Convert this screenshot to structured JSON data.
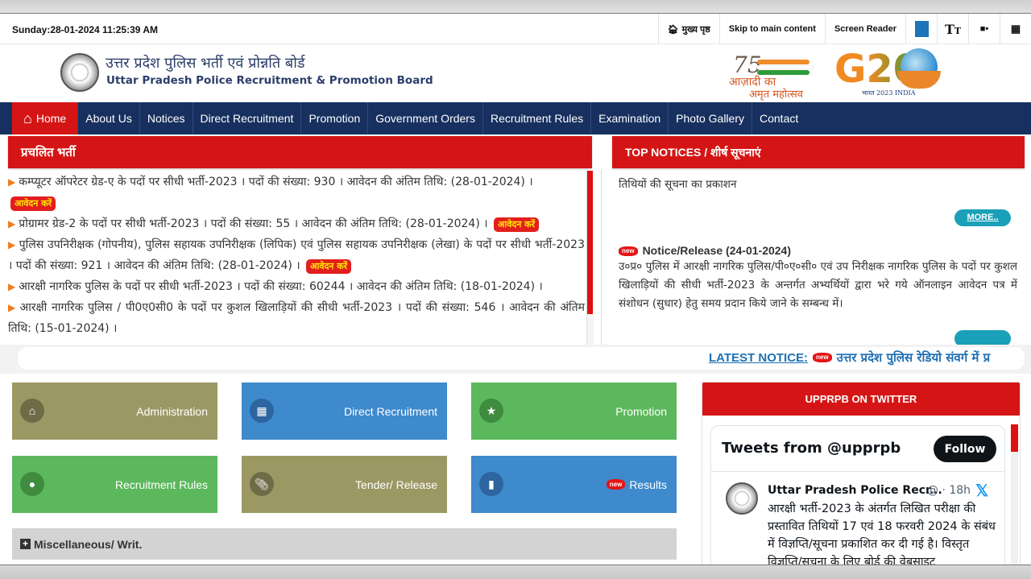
{
  "topbar": {
    "datetime": "Sunday:28-01-2024 11:25:39 AM",
    "links": [
      {
        "icon": "home-icon",
        "label": "मुख्य पृष्ठ"
      },
      {
        "label": "Skip to main content"
      },
      {
        "label": "Screen Reader"
      }
    ],
    "icons": [
      "color-theme-icon",
      "text-size-icon",
      "social-media-icon",
      "sitemap-icon"
    ],
    "theme_color": "#1e74b8"
  },
  "header": {
    "title_hindi": "उत्तर प्रदेश पुलिस भर्ती एवं प्रोन्नति बोर्ड",
    "title_english": "Uttar Pradesh Police Recruitment & Promotion Board",
    "azadi_line1": "आज़ादी का",
    "azadi_line2": "अमृत महोत्सव",
    "azadi_number": "75",
    "g20_text": "G20",
    "g20_sub": "भारत 2023 INDIA"
  },
  "nav": {
    "items": [
      "Home",
      "About Us",
      "Notices",
      "Direct Recruitment",
      "Promotion",
      "Government Orders",
      "Recruitment Rules",
      "Examination",
      "Photo Gallery",
      "Contact"
    ],
    "active": "Home"
  },
  "current_recruitment": {
    "title": "प्रचलित भर्ती",
    "apply_label": "आवेदन करें",
    "items": [
      {
        "text": "कम्प्यूटर ऑपरेटर ग्रेड-ए के पदों पर सीधी भर्ती-2023 । पदों की संख्या: 930 । आवेदन की अंतिम तिथि: (28-01-2024) ।",
        "apply": true
      },
      {
        "text": "प्रोग्रामर ग्रेड-2 के पदों पर सीधी भर्ती-2023 । पदों की संख्या: 55 । आवेदन की अंतिम तिथि: (28-01-2024) ।",
        "apply": true
      },
      {
        "text": "पुलिस उपनिरीक्षक (गोपनीय), पुलिस सहायक उपनिरीक्षक (लिपिक) एवं पुलिस सहायक उपनिरीक्षक (लेखा) के पदों पर सीधी भर्ती-2023 । पदों की संख्या: 921 । आवेदन की अंतिम तिथि: (28-01-2024) ।",
        "apply": true
      },
      {
        "text": "आरक्षी नागरिक पुलिस के पदों पर सीधी भर्ती-2023 । पदों की संख्या: 60244 । आवेदन की अंतिम तिथि: (18-01-2024) ।",
        "apply": false
      },
      {
        "text": "आरक्षी नागरिक पुलिस / पी0ए0सी0 के पदों पर कुशल खिलाड़ियों की सीधी भर्ती-2023 । पदों की संख्या: 546 । आवेदन की अंतिम तिथि: (15-01-2024) ।",
        "apply": false
      }
    ]
  },
  "top_notices": {
    "title": "TOP NOTICES / शीर्ष सूचनाएं",
    "partial_text": "तिथियों की सूचना का प्रकाशन",
    "more_label": "MORE..",
    "new_label": "new",
    "notice_title": "Notice/Release (24-01-2024)",
    "notice_text": "उ०प्र० पुलिस में आरक्षी नागरिक पुलिस/पी०ए०सी० एवं उप निरीक्षक नागरिक पुलिस के पदों पर कुशल खिलाड़ियों की सीधी भर्ती-2023 के अन्तर्गत अभ्यर्थियों द्वारा भरे गये ऑनलाइन आवेदन पत्र में संशोधन (सुधार) हेतु समय प्रदान किये जाने के सम्बन्ध में।"
  },
  "ticker": {
    "label": "LATEST NOTICE:",
    "new_label": "new",
    "text": "उत्तर प्रदेश पुलिस रेडियो संवर्ग में प्र"
  },
  "tiles": [
    {
      "label": "Administration",
      "icon": "home-icon",
      "color": "#9b9864"
    },
    {
      "label": "Direct Recruitment",
      "icon": "contact-book-icon",
      "color": "#3e8acc"
    },
    {
      "label": "Promotion",
      "icon": "medal-icon",
      "color": "#5cb85c"
    },
    {
      "label": "Recruitment Rules",
      "icon": "person-icon",
      "color": "#5cb85c"
    },
    {
      "label": "Tender/ Release",
      "icon": "paperclip-icon",
      "color": "#9b9864"
    },
    {
      "label": "Results",
      "icon": "bookmark-icon",
      "color": "#3e8acc",
      "new": "new"
    }
  ],
  "misc": {
    "label": "Miscellaneous/ Writ."
  },
  "twitter": {
    "heading": "UPPRPB ON TWITTER",
    "title": "Tweets from @upprpb",
    "follow_label": "Follow",
    "tweet": {
      "name": "Uttar Pradesh Police Recr...",
      "meta": "@ · 18h",
      "text": "आरक्षी भर्ती-2023 के अंतर्गत लिखित परीक्षा की प्रस्तावित तिथियों 17 एवं 18 फरवरी 2024 के संबंध में विज्ञप्ति/सूचना प्रकाशित कर दी गई है। विस्तृत विज्ञप्ति/सूचना के लिए बोर्ड की वेबसाइट"
    }
  },
  "colors": {
    "brand_red": "#d51515",
    "nav_blue": "#17305f",
    "apply_yellow": "#ffea00"
  }
}
